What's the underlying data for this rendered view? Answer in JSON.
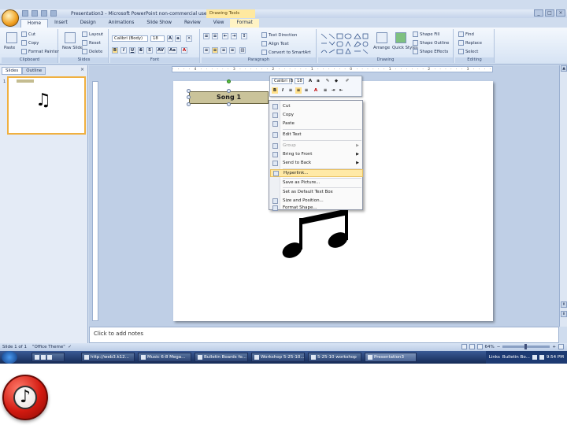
{
  "window": {
    "title": "Presentation3 - Microsoft PowerPoint non-commercial use",
    "context_title": "Drawing Tools"
  },
  "tabs": [
    "Home",
    "Insert",
    "Design",
    "Animations",
    "Slide Show",
    "Review",
    "View",
    "Format"
  ],
  "ribbon": {
    "clipboard": {
      "label": "Clipboard",
      "paste": "Paste",
      "cut": "Cut",
      "copy": "Copy",
      "format_painter": "Format Painter"
    },
    "slides": {
      "label": "Slides",
      "new_slide": "New Slide",
      "layout": "Layout",
      "reset": "Reset",
      "delete": "Delete"
    },
    "font": {
      "label": "Font",
      "font_name": "Calibri (Body)",
      "font_size": "18",
      "bold": "B",
      "italic": "I",
      "underline": "U",
      "strike": "S",
      "shadow": "S",
      "spacing": "AV",
      "case": "Aa",
      "color": "A"
    },
    "paragraph": {
      "label": "Paragraph",
      "text_direction": "Text Direction",
      "align_text": "Align Text",
      "smartart": "Convert to SmartArt"
    },
    "drawing": {
      "label": "Drawing",
      "arrange": "Arrange",
      "quick_styles": "Quick Styles",
      "shape_fill": "Shape Fill",
      "shape_outline": "Shape Outline",
      "shape_effects": "Shape Effects"
    },
    "editing": {
      "label": "Editing",
      "find": "Find",
      "replace": "Replace",
      "select": "Select"
    }
  },
  "pane": {
    "tab_slides": "Slides",
    "tab_outline": "Outline",
    "close": "×",
    "slide_number": "1"
  },
  "slide": {
    "textbox_text": "Song 1"
  },
  "mini_toolbar": {
    "font": "Calibri (B",
    "size": "18",
    "bold": "B",
    "italic": "I",
    "color": "A"
  },
  "context_menu": {
    "items": [
      {
        "label": "Cut",
        "disabled": false,
        "highlight": false,
        "submenu": false
      },
      {
        "label": "Copy",
        "disabled": false,
        "highlight": false,
        "submenu": false
      },
      {
        "label": "Paste",
        "disabled": false,
        "highlight": false,
        "submenu": false
      },
      {
        "label": "Edit Text",
        "disabled": false,
        "highlight": false,
        "submenu": false
      },
      {
        "label": "Group",
        "disabled": true,
        "highlight": false,
        "submenu": true
      },
      {
        "label": "Bring to Front",
        "disabled": false,
        "highlight": false,
        "submenu": true
      },
      {
        "label": "Send to Back",
        "disabled": false,
        "highlight": false,
        "submenu": true
      },
      {
        "label": "Hyperlink...",
        "disabled": false,
        "highlight": true,
        "submenu": false
      },
      {
        "label": "Save as Picture...",
        "disabled": false,
        "highlight": false,
        "submenu": false
      },
      {
        "label": "Set as Default Text Box",
        "disabled": false,
        "highlight": false,
        "submenu": false
      },
      {
        "label": "Size and Position...",
        "disabled": false,
        "highlight": false,
        "submenu": false
      },
      {
        "label": "Format Shape...",
        "disabled": false,
        "highlight": false,
        "submenu": false
      }
    ]
  },
  "notes": {
    "placeholder": "Click to add notes"
  },
  "status": {
    "slide_info": "Slide 1 of 1",
    "theme": "\"Office Theme\"",
    "zoom": "64%"
  },
  "taskbar": {
    "items": [
      "http://web3.k12...",
      "Music 6-8 Mega...",
      "Bulletin Boards fo...",
      "Workshop 5-25-10...",
      "5-25-10 workshop",
      "Presentation3"
    ],
    "tray_links": "Links",
    "tray_app": "Bulletin Bo...",
    "clock": "9:54 PM"
  },
  "colors": {
    "accent": "#ffe9a6",
    "ribbon": "#d6e3f4",
    "taskbar": "#1d3a72",
    "textbox": "#cac39a",
    "app_icon": "#d21a10"
  },
  "icons": {
    "slide_notes": "music-note-icon",
    "bottom_app": "music-note-badge-icon"
  }
}
